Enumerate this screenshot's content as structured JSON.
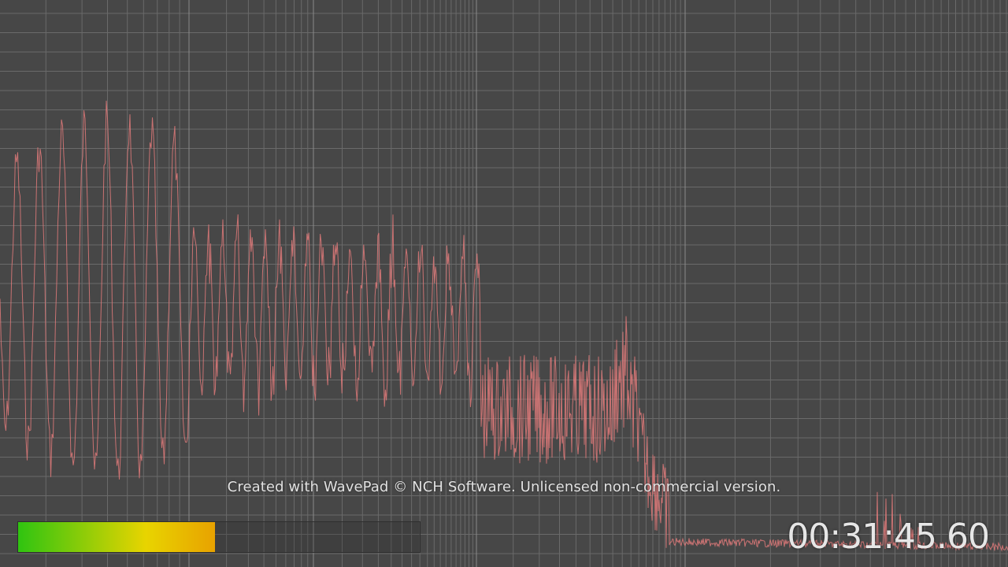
{
  "watermark": "Created with WavePad © NCH Software. Unlicensed non-commercial version.",
  "time_display": "00:31:45.60",
  "level_meter": {
    "level_fraction": 0.49,
    "gradient_colors": [
      "#2fc411",
      "#e8d400",
      "#e8a200"
    ],
    "empty_color": "#2f2f2f"
  },
  "spectrum": {
    "line_color": "#e07a7a",
    "grid_color": "#6a6a6a",
    "grid_major_color": "#8a8a8a",
    "background_color": "#474747"
  }
}
